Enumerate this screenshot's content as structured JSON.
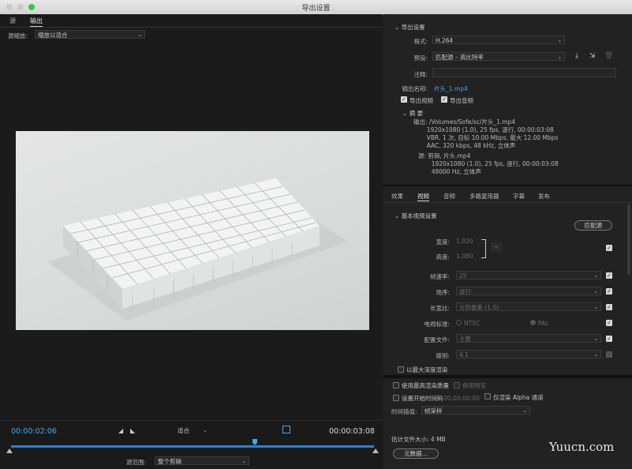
{
  "window": {
    "title": "导出设置"
  },
  "left": {
    "tabs": [
      "源",
      "输出"
    ],
    "scale_label": "源缩放:",
    "scale_value": "缩放以适合",
    "timecode_current": "00:00:02:06",
    "timecode_end": "00:00:03:08",
    "fit_value": "适合",
    "range_label": "源范围:",
    "range_value": "整个剪辑"
  },
  "export_settings": {
    "header": "导出设置",
    "format_label": "格式:",
    "format_value": "H.264",
    "preset_label": "预设:",
    "preset_value": "匹配源 – 高比特率",
    "comment_label": "注释:",
    "comment_value": "",
    "output_name_label": "输出名称:",
    "output_name_value": "片头_1.mp4",
    "export_video_label": "导出视频",
    "export_audio_label": "导出音频",
    "summary_header": "摘 要",
    "summary_output": "输出: /Volumes/Sofe/sc/片头_1.mp4\n       1920x1080 (1.0), 25 fps, 逐行, 00:00:03:08\n       VBR, 1 次, 目标 10.00 Mbps, 最大 12.00 Mbps\n       AAC, 320 kbps, 48 kHz, 立体声",
    "summary_source": "源: 剪辑, 片头.mp4\n       1920x1080 (1.0), 25 fps, 逐行, 00:00:03:08\n       48000 Hz, 立体声"
  },
  "panel_tabs": [
    "效果",
    "视频",
    "音频",
    "多路复用器",
    "字幕",
    "发布"
  ],
  "video": {
    "section": "基本视频设置",
    "match_source_button": "匹配源",
    "width_label": "宽度:",
    "width_value": "1,920",
    "height_label": "高度:",
    "height_value": "1,080",
    "frame_rate_label": "帧速率:",
    "frame_rate_value": "25",
    "field_order_label": "场序:",
    "field_order_value": "逐行",
    "aspect_label": "长宽比:",
    "aspect_value": "方形像素 (1.0)",
    "tv_standard_label": "电视标准:",
    "ntsc_label": "NTSC",
    "pal_label": "PAL",
    "profile_label": "配置文件:",
    "profile_value": "主要",
    "level_label": "级别:",
    "level_value": "4.1",
    "max_depth_label": "以最大深度渲染"
  },
  "bottom": {
    "max_render_quality": "使用最高渲染质量",
    "use_preview": "使用预览",
    "set_start_tc": "设置开始时间码",
    "start_tc_value": "00:00:00:00",
    "render_alpha": "仅渲染 Alpha 通道",
    "interp_label": "时间插值:",
    "interp_value": "帧采样",
    "est_size": "估计文件大小: 4 MB",
    "metadata_button": "元数据..."
  },
  "watermark": "Yuucn.com",
  "colors": {
    "accent": "#4fa3e8"
  }
}
